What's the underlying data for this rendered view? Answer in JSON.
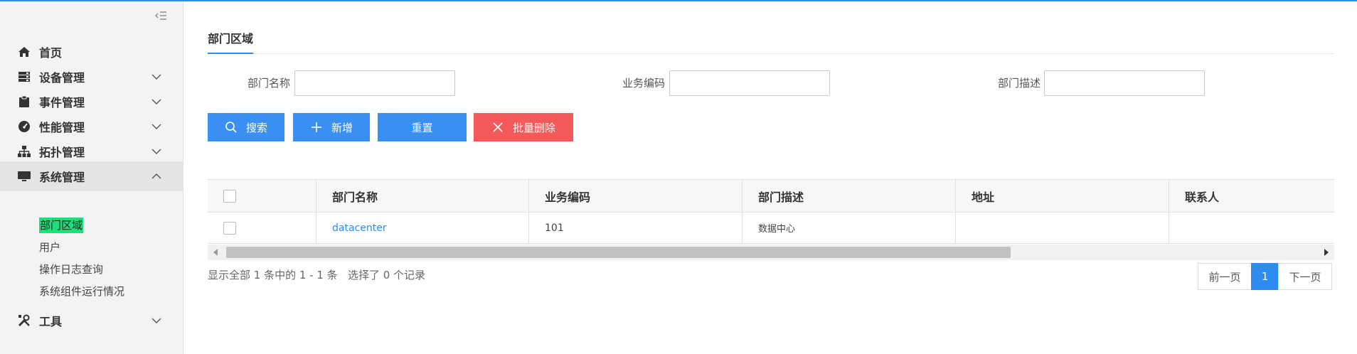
{
  "sidebar": {
    "items": [
      {
        "label": "首页",
        "icon": "home-icon"
      },
      {
        "label": "设备管理",
        "icon": "server-icon"
      },
      {
        "label": "事件管理",
        "icon": "clipboard-icon"
      },
      {
        "label": "性能管理",
        "icon": "dashboard-icon"
      },
      {
        "label": "拓扑管理",
        "icon": "sitemap-icon"
      },
      {
        "label": "系统管理",
        "icon": "monitor-icon"
      },
      {
        "label": "工具",
        "icon": "tools-icon"
      }
    ],
    "subitems": [
      "部门区域",
      "用户",
      "操作日志查询",
      "系统组件运行情况"
    ]
  },
  "tab": {
    "label": "部门区域"
  },
  "form": {
    "dept_name_label": "部门名称",
    "biz_code_label": "业务编码",
    "dept_desc_label": "部门描述",
    "dept_name_value": "",
    "biz_code_value": "",
    "dept_desc_value": ""
  },
  "buttons": {
    "search": "搜索",
    "add": "新增",
    "reset": "重置",
    "batch_delete": "批量删除"
  },
  "table": {
    "headers": [
      "部门名称",
      "业务编码",
      "部门描述",
      "地址",
      "联系人"
    ],
    "rows": [
      {
        "dept_name": "datacenter",
        "biz_code": "101",
        "desc": "数据中心",
        "address": "",
        "contact": ""
      }
    ]
  },
  "footer": {
    "info": "显示全部 1 条中的 1 - 1 条   选择了 0 个记录",
    "prev": "前一页",
    "page": "1",
    "next": "下一页"
  },
  "colors": {
    "accent": "#2d8cf0",
    "button_blue": "#3a90f2",
    "button_red": "#f45a5a",
    "active_sub_highlight": "#1de07a"
  }
}
